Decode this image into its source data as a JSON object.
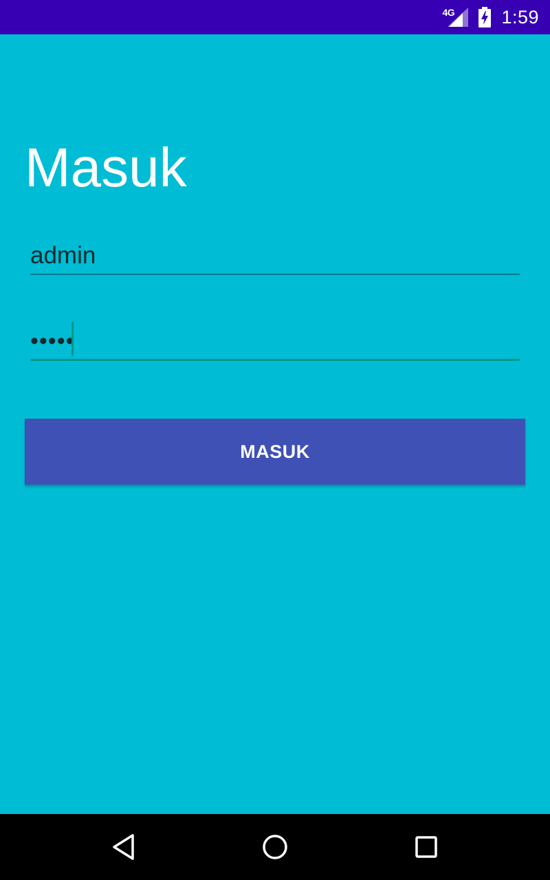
{
  "status_bar": {
    "network_label": "4G",
    "signal_icon": "cell-signal-icon",
    "battery_icon": "battery-charging-icon",
    "time": "1:59"
  },
  "login": {
    "title": "Masuk",
    "username_value": "admin",
    "password_value": "•••••",
    "submit_label": "MASUK"
  },
  "nav_bar": {
    "back_icon": "back-triangle-icon",
    "home_icon": "home-circle-icon",
    "recents_icon": "recents-square-icon"
  },
  "colors": {
    "background": "#00bcd4",
    "status_bar": "#3700b3",
    "button": "#3f51b5",
    "accent": "#009688",
    "nav_bar": "#000000"
  }
}
